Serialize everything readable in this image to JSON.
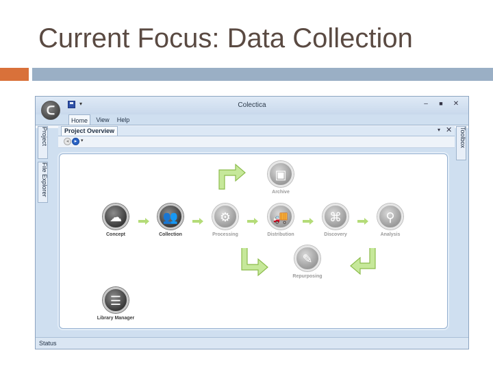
{
  "slide": {
    "title": "Current Focus: Data Collection"
  },
  "window": {
    "title": "Colectica",
    "controls": {
      "minimize": "–",
      "maximize": "■",
      "close": "✕"
    },
    "quick_access_dropdown": "▾",
    "orb_glyph": "ᑕ"
  },
  "ribbon": {
    "tabs": [
      {
        "label": "Home"
      },
      {
        "label": "View"
      },
      {
        "label": "Help"
      }
    ]
  },
  "side_tabs": {
    "left": [
      "Project",
      "File Explorer"
    ],
    "right": [
      "Toolbox"
    ]
  },
  "panel": {
    "tab_label": "Project Overview",
    "pin": "▾",
    "close": "✕"
  },
  "nav": {
    "back": "◂",
    "forward": "▸",
    "dropdown": "▾"
  },
  "workflow": {
    "nodes": [
      {
        "label": "Archive",
        "icon": "archive-icon",
        "glyph": "▣",
        "state": "inactive"
      },
      {
        "label": "Concept",
        "icon": "concept-cloud-icon",
        "glyph": "☁",
        "state": "active"
      },
      {
        "label": "Collection",
        "icon": "collection-people-icon",
        "glyph": "👥",
        "state": "active"
      },
      {
        "label": "Processing",
        "icon": "processing-gear-icon",
        "glyph": "⚙",
        "state": "inactive"
      },
      {
        "label": "Distribution",
        "icon": "distribution-truck-icon",
        "glyph": "🚚",
        "state": "inactive"
      },
      {
        "label": "Discovery",
        "icon": "discovery-binoculars-icon",
        "glyph": "⌘",
        "state": "inactive"
      },
      {
        "label": "Analysis",
        "icon": "analysis-magnifier-icon",
        "glyph": "⚲",
        "state": "inactive"
      },
      {
        "label": "Repurposing",
        "icon": "repurposing-tools-icon",
        "glyph": "✎",
        "state": "inactive"
      },
      {
        "label": "Library Manager",
        "icon": "library-books-icon",
        "glyph": "☰",
        "state": "active"
      }
    ],
    "arrow_color": "#b4dc78"
  },
  "status_bar": {
    "text": "Status"
  }
}
